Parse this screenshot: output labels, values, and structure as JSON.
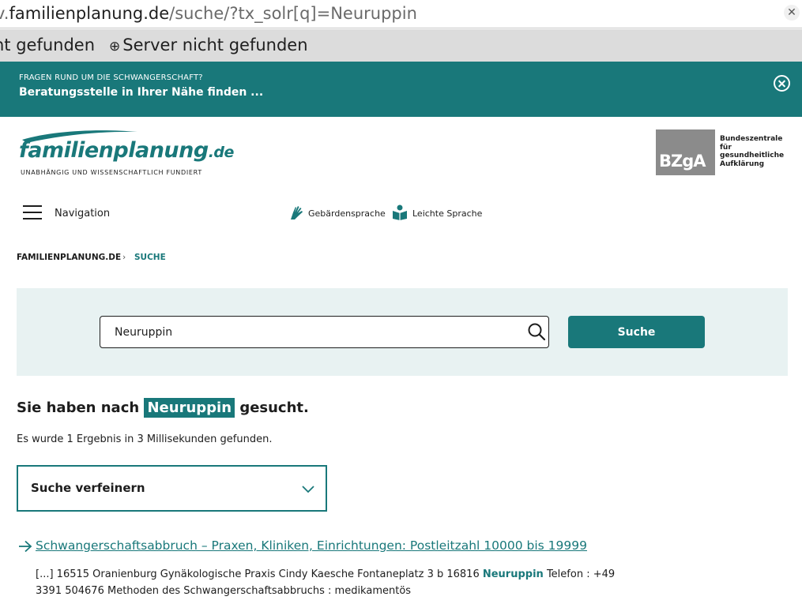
{
  "browser": {
    "url_prefix": "v.",
    "url_host": "familienplanung.de",
    "url_path": "/suche/?tx_solr[q]=Neuruppin",
    "tabs": [
      "nt gefunden",
      "Server nicht gefunden"
    ],
    "close_glyph": "✕"
  },
  "banner": {
    "small_text": "FRAGEN RUND UM DIE SCHWANGERSCHAFT?",
    "link_text": "Beratungsstelle in Ihrer Nähe finden ...",
    "bg_color": "#19787a"
  },
  "header": {
    "logo_main": "familienplanung",
    "logo_tld": ".de",
    "logo_tagline": "UNABHÄNGIG UND WISSENSCHAFTLICH FUNDIERT",
    "bzga_mark": "BZgA",
    "bzga_lines": [
      "Bundeszentrale",
      "für",
      "gesundheitliche",
      "Aufklärung"
    ]
  },
  "nav": {
    "menu_label": "Navigation",
    "sign_language": "Gebärdensprache",
    "easy_language": "Leichte Sprache"
  },
  "breadcrumb": {
    "home": "FAMILIENPLANUNG.DE",
    "separator": "›",
    "current": "SUCHE"
  },
  "search": {
    "query": "Neuruppin",
    "button_label": "Suche"
  },
  "results": {
    "heading_before": "Sie haben nach",
    "heading_term": "Neuruppin",
    "heading_after": "gesucht.",
    "count_text": "Es wurde 1 Ergebnis in 3 Millisekunden gefunden.",
    "refine_label": "Suche verfeinern",
    "items": [
      {
        "title": "Schwangerschaftsabbruch – Praxen, Kliniken, Einrichtungen: Postleitzahl 10000 bis 19999",
        "snippet_before": "[...] 16515 Oranienburg Gynäkologische Praxis Cindy Kaesche Fontaneplatz 3 b 16816",
        "snippet_highlight": "Neuruppin",
        "snippet_after": "Telefon : +49 3391 504676 Methoden des Schwangerschaftsabbruchs : medikamentös"
      }
    ]
  },
  "theme": {
    "accent": "#19787a",
    "panel_bg": "#e8f2f2",
    "bzga_gray": "#8b8b8b"
  }
}
